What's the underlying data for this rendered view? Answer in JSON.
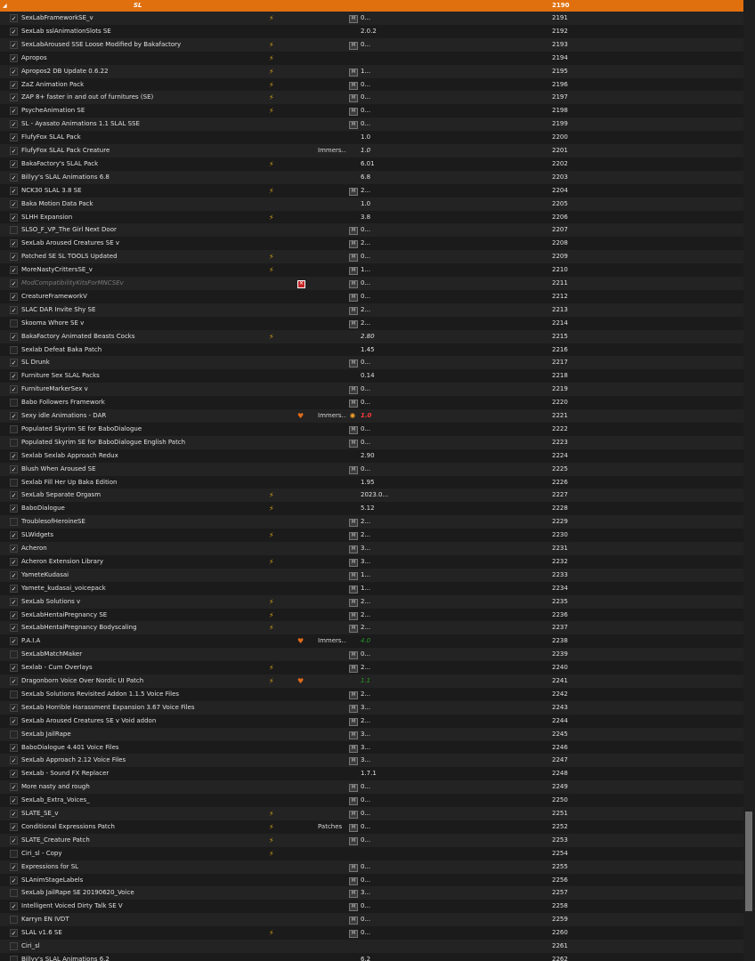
{
  "separator": {
    "name": "SL",
    "priority": "2190",
    "arrow": "◢"
  },
  "rows": [
    {
      "name": "SexLabFrameworkSE_v",
      "checked": true,
      "flag": "bolt",
      "content": "",
      "src": "M",
      "version": "0...",
      "priority": "2191"
    },
    {
      "name": "SexLab sslAnimationSlots SE",
      "checked": true,
      "flag": "",
      "content": "",
      "src": "",
      "version": "2.0.2",
      "priority": "2192"
    },
    {
      "name": "SexLabAroused SSE Loose Modified by Bakafactory",
      "checked": true,
      "flag": "bolt2",
      "content": "",
      "src": "M",
      "version": "0...",
      "priority": "2193"
    },
    {
      "name": "Apropos",
      "checked": true,
      "flag": "bolt2",
      "content": "",
      "src": "",
      "version": "",
      "priority": "2194"
    },
    {
      "name": "Apropos2 DB Update 0.6.22",
      "checked": true,
      "flag": "bolt",
      "content": "",
      "src": "M",
      "version": "1...",
      "priority": "2195"
    },
    {
      "name": "ZaZ Animation Pack",
      "checked": true,
      "flag": "bolt",
      "content": "",
      "src": "M",
      "version": "0...",
      "priority": "2196"
    },
    {
      "name": "ZAP 8+ faster in and out of furnitures (SE)",
      "checked": true,
      "flag": "bolt",
      "content": "",
      "src": "M",
      "version": "0...",
      "priority": "2197"
    },
    {
      "name": "PsycheAnimation SE",
      "checked": true,
      "flag": "bolt2",
      "content": "",
      "src": "M",
      "version": "0...",
      "priority": "2198"
    },
    {
      "name": "SL - Ayasato Animations 1.1 SLAL SSE",
      "checked": true,
      "flag": "",
      "content": "",
      "src": "M",
      "version": "0...",
      "priority": "2199"
    },
    {
      "name": "FlufyFox SLAL Pack",
      "checked": true,
      "flag": "",
      "content": "",
      "src": "",
      "version": "1.0",
      "priority": "2200"
    },
    {
      "name": "FlufyFox SLAL Pack Creature",
      "checked": true,
      "flag": "",
      "content": "Immers...",
      "src": "",
      "version": "1.0",
      "versionStyle": "italic",
      "priority": "2201"
    },
    {
      "name": "BakaFactory's SLAL Pack",
      "checked": true,
      "flag": "bolt",
      "content": "",
      "src": "",
      "version": "6.01",
      "priority": "2202"
    },
    {
      "name": "Billyy's SLAL Animations 6.8",
      "checked": true,
      "flag": "",
      "content": "",
      "src": "",
      "version": "6.8",
      "priority": "2203"
    },
    {
      "name": "NCK30 SLAL 3.8 SE",
      "checked": true,
      "flag": "bolt",
      "content": "",
      "src": "M",
      "version": "2...",
      "priority": "2204"
    },
    {
      "name": "Baka Motion Data Pack",
      "checked": true,
      "flag": "",
      "content": "",
      "src": "",
      "version": "1.0",
      "priority": "2205"
    },
    {
      "name": "SLHH Expansion",
      "checked": true,
      "flag": "bolt2",
      "content": "",
      "src": "",
      "version": "3.8",
      "priority": "2206"
    },
    {
      "name": "SLSO_F_VP_The Girl Next Door",
      "checked": false,
      "flag": "",
      "content": "",
      "src": "M",
      "version": "0...",
      "priority": "2207"
    },
    {
      "name": "SexLab Aroused Creatures SE v",
      "checked": true,
      "flag": "",
      "content": "",
      "src": "M",
      "version": "2...",
      "priority": "2208"
    },
    {
      "name": "Patched SE SL TOOLS Updated",
      "checked": true,
      "flag": "bolt",
      "content": "",
      "src": "M",
      "version": "0...",
      "priority": "2209"
    },
    {
      "name": "MoreNastyCrittersSE_v",
      "checked": true,
      "flag": "bolt",
      "content": "",
      "src": "M",
      "version": "1...",
      "priority": "2210"
    },
    {
      "name": "ModCompatibilityKitsForMNCSEv",
      "checked": true,
      "italic": true,
      "flag": "err",
      "content": "",
      "src": "M",
      "version": "0...",
      "priority": "2211"
    },
    {
      "name": "CreatureFrameworkV",
      "checked": true,
      "flag": "",
      "content": "",
      "src": "M",
      "version": "0...",
      "priority": "2212"
    },
    {
      "name": "SLAC DAR Invite Shy SE",
      "checked": true,
      "flag": "",
      "content": "",
      "src": "M",
      "version": "2...",
      "priority": "2213"
    },
    {
      "name": "Skooma Whore SE v",
      "checked": false,
      "flag": "",
      "content": "",
      "src": "M",
      "version": "2...",
      "priority": "2214"
    },
    {
      "name": "BakaFactory Animated Beasts Cocks",
      "checked": true,
      "flag": "bolt",
      "content": "",
      "src": "",
      "version": "2.80",
      "versionStyle": "italic",
      "priority": "2215"
    },
    {
      "name": "Sexlab Defeat Baka Patch",
      "checked": false,
      "flag": "",
      "content": "",
      "src": "",
      "version": "1.45",
      "priority": "2216"
    },
    {
      "name": "SL Drunk",
      "checked": true,
      "flag": "",
      "content": "",
      "src": "M",
      "version": "0...",
      "priority": "2217"
    },
    {
      "name": "Furniture Sex SLAL Packs",
      "checked": true,
      "flag": "",
      "content": "",
      "src": "",
      "version": "0.14",
      "priority": "2218"
    },
    {
      "name": "FurnitureMarkerSex v",
      "checked": true,
      "flag": "",
      "content": "",
      "src": "M",
      "version": "0...",
      "priority": "2219"
    },
    {
      "name": "Babo Followers Framework",
      "checked": false,
      "flag": "",
      "content": "",
      "src": "M",
      "version": "0...",
      "priority": "2220"
    },
    {
      "name": "Sexy idle Animations - DAR",
      "checked": true,
      "flag": "heart",
      "content": "Immers...",
      "src": "sun",
      "version": "1.0",
      "versionStyle": "red",
      "priority": "2221"
    },
    {
      "name": "Populated Skyrim SE for BaboDialogue",
      "checked": false,
      "flag": "",
      "content": "",
      "src": "M",
      "version": "0...",
      "priority": "2222"
    },
    {
      "name": "Populated Skyrim SE for BaboDialogue English Patch",
      "checked": false,
      "flag": "",
      "content": "",
      "src": "M",
      "version": "0...",
      "priority": "2223"
    },
    {
      "name": "Sexlab Sexlab Approach Redux",
      "checked": true,
      "flag": "",
      "content": "",
      "src": "",
      "version": "2.90",
      "priority": "2224"
    },
    {
      "name": "Blush When Aroused SE",
      "checked": true,
      "flag": "",
      "content": "",
      "src": "M",
      "version": "0...",
      "priority": "2225"
    },
    {
      "name": "Sexlab Fill Her Up Baka Edition",
      "checked": false,
      "flag": "",
      "content": "",
      "src": "",
      "version": "1.95",
      "priority": "2226"
    },
    {
      "name": "SexLab Separate Orgasm",
      "checked": true,
      "flag": "bolt",
      "content": "",
      "src": "",
      "version": "2023.0...",
      "priority": "2227"
    },
    {
      "name": "BaboDialogue",
      "checked": true,
      "flag": "bolt",
      "content": "",
      "src": "",
      "version": "5.12",
      "priority": "2228"
    },
    {
      "name": "TroublesofHeroineSE",
      "checked": false,
      "flag": "",
      "content": "",
      "src": "M",
      "version": "2...",
      "priority": "2229"
    },
    {
      "name": "SLWidgets",
      "checked": true,
      "flag": "bolt",
      "content": "",
      "src": "M",
      "version": "2...",
      "priority": "2230"
    },
    {
      "name": "Acheron",
      "checked": true,
      "flag": "",
      "content": "",
      "src": "M",
      "version": "3...",
      "priority": "2231"
    },
    {
      "name": "Acheron Extension Library",
      "checked": true,
      "flag": "bolt",
      "content": "",
      "src": "M",
      "version": "3...",
      "priority": "2232"
    },
    {
      "name": "YameteKudasai",
      "checked": true,
      "flag": "",
      "content": "",
      "src": "M",
      "version": "1...",
      "priority": "2233"
    },
    {
      "name": "Yamete_kudasai_voicepack",
      "checked": true,
      "flag": "",
      "content": "",
      "src": "M",
      "version": "1...",
      "priority": "2234"
    },
    {
      "name": "SexLab Solutions v",
      "checked": true,
      "flag": "bolt",
      "content": "",
      "src": "M",
      "version": "2...",
      "priority": "2235"
    },
    {
      "name": "SexLabHentaiPregnancy SE",
      "checked": true,
      "flag": "bolt2",
      "content": "",
      "src": "M",
      "version": "2...",
      "priority": "2236"
    },
    {
      "name": "SexLabHentaiPregnancy Bodyscaling",
      "checked": true,
      "flag": "bolt",
      "content": "",
      "src": "M",
      "version": "2...",
      "priority": "2237"
    },
    {
      "name": "P.A.I.A",
      "checked": true,
      "flag": "heart",
      "content": "Immers...",
      "src": "",
      "version": "4.0",
      "versionStyle": "green",
      "priority": "2238"
    },
    {
      "name": "SexLabMatchMaker",
      "checked": false,
      "flag": "",
      "content": "",
      "src": "M",
      "version": "0...",
      "priority": "2239"
    },
    {
      "name": "Sexlab - Cum Overlays",
      "checked": true,
      "flag": "bolt",
      "content": "",
      "src": "M",
      "version": "2...",
      "priority": "2240"
    },
    {
      "name": "Dragonborn Voice Over Nordic UI Patch",
      "checked": true,
      "flag": "bolt",
      "flag2": "heart",
      "content": "",
      "src": "",
      "version": "1.1",
      "versionStyle": "green",
      "priority": "2241"
    },
    {
      "name": "SexLab Solutions Revisited Addon 1.1.5 Voice Files",
      "checked": false,
      "flag": "",
      "content": "",
      "src": "M",
      "version": "2...",
      "priority": "2242"
    },
    {
      "name": "SexLab Horrible Harassment Expansion 3.67 Voice Files",
      "checked": true,
      "flag": "",
      "content": "",
      "src": "M",
      "version": "3...",
      "priority": "2243"
    },
    {
      "name": "SexLab Aroused Creatures SE v Void addon",
      "checked": true,
      "flag": "",
      "content": "",
      "src": "M",
      "version": "2...",
      "priority": "2244"
    },
    {
      "name": "SexLab JailRape",
      "checked": false,
      "flag": "",
      "content": "",
      "src": "M",
      "version": "3...",
      "priority": "2245"
    },
    {
      "name": "BaboDialogue 4.401 Voice Files",
      "checked": true,
      "flag": "",
      "content": "",
      "src": "M",
      "version": "3...",
      "priority": "2246"
    },
    {
      "name": "SexLab Approach 2.12 Voice Files",
      "checked": true,
      "flag": "",
      "content": "",
      "src": "M",
      "version": "3...",
      "priority": "2247"
    },
    {
      "name": "SexLab - Sound FX Replacer",
      "checked": true,
      "flag": "",
      "content": "",
      "src": "",
      "version": "1.7.1",
      "priority": "2248"
    },
    {
      "name": "More nasty and rough",
      "checked": true,
      "flag": "",
      "content": "",
      "src": "M",
      "version": "0...",
      "priority": "2249"
    },
    {
      "name": "SexLab_Extra_Voices_",
      "checked": true,
      "flag": "",
      "content": "",
      "src": "M",
      "version": "0...",
      "priority": "2250"
    },
    {
      "name": "SLATE_SE_v",
      "checked": true,
      "flag": "bolt2",
      "content": "",
      "src": "M",
      "version": "0...",
      "priority": "2251"
    },
    {
      "name": "Conditional Expressions Patch",
      "checked": true,
      "flag": "bolt",
      "content": "Patches",
      "src": "M",
      "version": "0...",
      "priority": "2252"
    },
    {
      "name": "SLATE_Creature Patch",
      "checked": true,
      "flag": "bolt",
      "content": "",
      "src": "M",
      "version": "0...",
      "priority": "2253"
    },
    {
      "name": "Ciri_sl - Copy",
      "checked": false,
      "flag": "bolt",
      "content": "",
      "src": "",
      "version": "",
      "priority": "2254"
    },
    {
      "name": "Expressions for SL",
      "checked": true,
      "flag": "",
      "content": "",
      "src": "M",
      "version": "0...",
      "priority": "2255"
    },
    {
      "name": "SLAnimStageLabels",
      "checked": true,
      "flag": "",
      "content": "",
      "src": "M",
      "version": "0...",
      "priority": "2256"
    },
    {
      "name": "SexLab JailRape SE 20190620_Voice",
      "checked": false,
      "flag": "",
      "content": "",
      "src": "M",
      "version": "3...",
      "priority": "2257"
    },
    {
      "name": "Intelligent Voiced Dirty Talk SE V",
      "checked": true,
      "flag": "",
      "content": "",
      "src": "M",
      "version": "0...",
      "priority": "2258"
    },
    {
      "name": "Karryn EN IVDT",
      "checked": false,
      "flag": "",
      "content": "",
      "src": "M",
      "version": "0...",
      "priority": "2259"
    },
    {
      "name": "SLAL v1.6 SE",
      "checked": true,
      "flag": "bolt",
      "content": "",
      "src": "M",
      "version": "0...",
      "priority": "2260"
    },
    {
      "name": "Ciri_sl",
      "checked": false,
      "flag": "",
      "content": "",
      "src": "",
      "version": "",
      "priority": "2261"
    },
    {
      "name": "Billyy's SLAL Animations 6.2",
      "checked": false,
      "flag": "",
      "content": "",
      "src": "",
      "version": "6.2",
      "priority": "2262"
    }
  ],
  "icons": {
    "checkmark": "✓",
    "bolt": "⚡",
    "heart": "♥",
    "error": "✕",
    "source_marker": "M",
    "sun": "✺"
  },
  "colors": {
    "separator": "#e0700e",
    "error_version": "#ff3a3a",
    "newer_version": "#2a9c2a"
  }
}
